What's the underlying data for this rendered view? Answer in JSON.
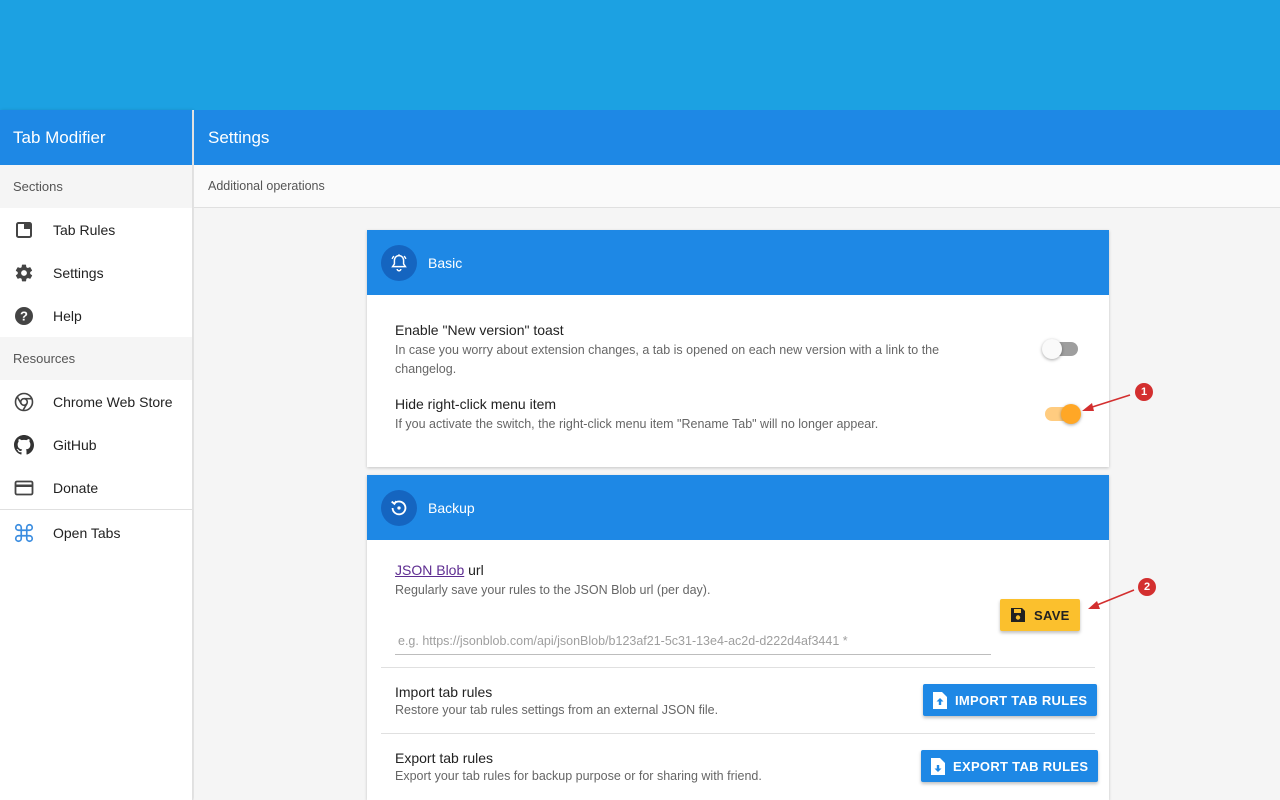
{
  "sidebar": {
    "title": "Tab Modifier",
    "sections_label": "Sections",
    "items": [
      {
        "label": "Tab Rules",
        "icon": "tab-icon"
      },
      {
        "label": "Settings",
        "icon": "gear-icon"
      },
      {
        "label": "Help",
        "icon": "help-icon"
      }
    ],
    "resources_label": "Resources",
    "resources": [
      {
        "label": "Chrome Web Store",
        "icon": "chrome-icon"
      },
      {
        "label": "GitHub",
        "icon": "github-icon"
      },
      {
        "label": "Donate",
        "icon": "credit-card-icon"
      }
    ],
    "open_tabs": {
      "label": "Open Tabs",
      "icon": "command-icon"
    }
  },
  "header": {
    "title": "Settings",
    "subtitle": "Additional operations"
  },
  "basic": {
    "title": "Basic",
    "toast": {
      "title": "Enable \"New version\" toast",
      "desc": "In case you worry about extension changes, a tab is opened on each new version with a link to the changelog.",
      "enabled": false
    },
    "hide_menu": {
      "title": "Hide right-click menu item",
      "desc": "If you activate the switch, the right-click menu item \"Rename Tab\" will no longer appear.",
      "enabled": true
    }
  },
  "backup": {
    "title": "Backup",
    "json_blob_link": "JSON Blob",
    "json_blob_suffix": " url",
    "json_blob_desc": "Regularly save your rules to the JSON Blob url (per day).",
    "url_placeholder": "e.g. https://jsonblob.com/api/jsonBlob/b123af21-5c31-13e4-ac2d-d222d4af3441 *",
    "save_label": "SAVE",
    "import": {
      "title": "Import tab rules",
      "desc": "Restore your tab rules settings from an external JSON file.",
      "button": "IMPORT TAB RULES"
    },
    "export": {
      "title": "Export tab rules",
      "desc": "Export your tab rules for backup purpose or for sharing with friend.",
      "button": "EXPORT TAB RULES"
    }
  },
  "annotations": [
    "1",
    "2"
  ],
  "colors": {
    "primary": "#1e88e5",
    "banner": "#1ca1e2",
    "accent": "#ffa726",
    "save": "#fbc02d",
    "marker": "#d32f2f"
  }
}
